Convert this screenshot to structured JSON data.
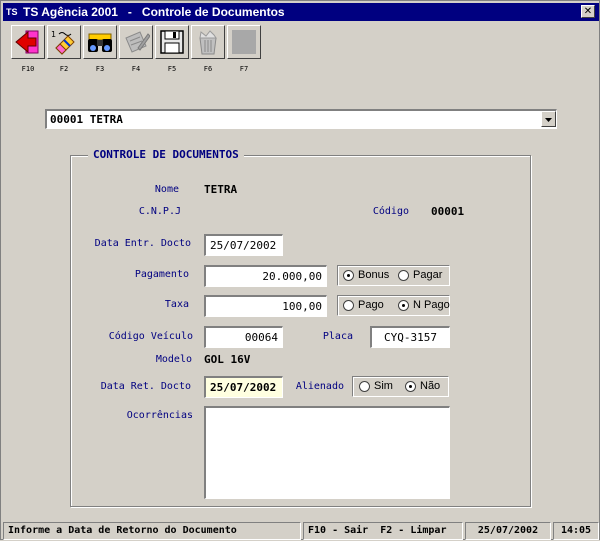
{
  "window": {
    "app_icon": "TS",
    "title": "TS Agência 2001   -   Controle de Documentos",
    "close_label": "✕"
  },
  "toolbar": {
    "buttons": [
      {
        "icon": "exit-arrow-icon",
        "key": "F10"
      },
      {
        "icon": "clear-eraser-icon",
        "key": "F2"
      },
      {
        "icon": "binoculars-icon",
        "key": "F3"
      },
      {
        "icon": "edit-document-icon",
        "key": "F4"
      },
      {
        "icon": "save-disk-icon",
        "key": "F5"
      },
      {
        "icon": "trash-icon",
        "key": "F6"
      },
      {
        "icon": "blank-icon",
        "key": "F7"
      }
    ]
  },
  "selector": {
    "value": "00001 TETRA"
  },
  "form": {
    "group_title": "CONTROLE DE DOCUMENTOS",
    "nome_label": "Nome",
    "nome_value": "TETRA",
    "cnpj_label": "C.N.P.J",
    "codigo_label": "Código",
    "codigo_value": "00001",
    "data_entr_label": "Data Entr. Docto",
    "data_entr_value": "25/07/2002",
    "pagamento_label": "Pagamento",
    "pagamento_value": "20.000,00",
    "pagamento_options": [
      {
        "label": "Bonus",
        "selected": true
      },
      {
        "label": "Pagar",
        "selected": false
      }
    ],
    "taxa_label": "Taxa",
    "taxa_value": "100,00",
    "taxa_options": [
      {
        "label": "Pago",
        "selected": false
      },
      {
        "label": "N Pago",
        "selected": true
      }
    ],
    "codigo_veiculo_label": "Código Veículo",
    "codigo_veiculo_value": "00064",
    "placa_label": "Placa",
    "placa_value": "CYQ-3157",
    "modelo_label": "Modelo",
    "modelo_value": "GOL 16V",
    "data_ret_label": "Data Ret. Docto",
    "data_ret_value": "25/07/2002",
    "alienado_label": "Alienado",
    "alienado_options": [
      {
        "label": "Sim",
        "selected": false
      },
      {
        "label": "Não",
        "selected": true
      }
    ],
    "ocorrencias_label": "Ocorrências",
    "ocorrencias_value": ""
  },
  "status": {
    "message": "Informe a Data de Retorno do Documento",
    "shortcuts": "F10 - Sair  F2 - Limpar",
    "date": "25/07/2002",
    "time": "14:05"
  }
}
